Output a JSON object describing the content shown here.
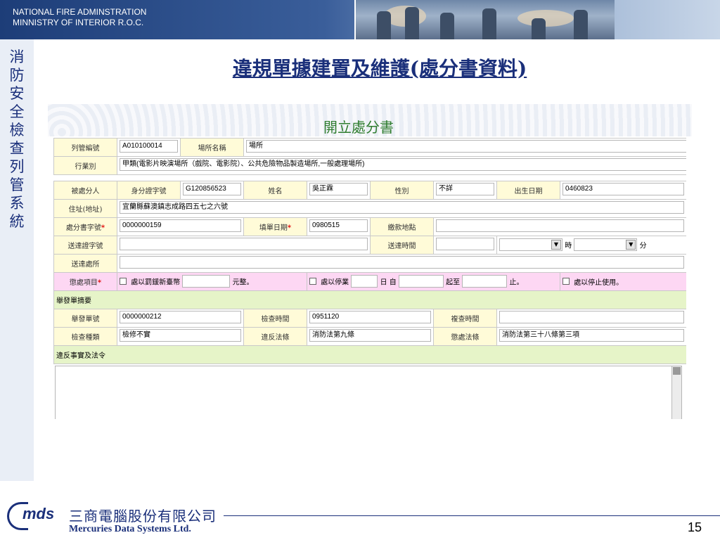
{
  "header": {
    "org_line1": "NATIONAL FIRE ADMINSTRATION",
    "org_line2": "MINNISTRY OF INTERIOR R.O.C."
  },
  "sidebar": {
    "system_name": "消防安全檢查列管系統"
  },
  "slide": {
    "title": "違規單據建置及維護(處分書資料)"
  },
  "form": {
    "title": "開立處分書",
    "row1": {
      "list_no_label": "列管編號",
      "list_no": "A010100014",
      "place_name_label": "場所名稱",
      "place_name": "場所"
    },
    "row2": {
      "category_label": "行業別",
      "category": "甲類(電影片映演場所（戲院、電影院）、公共危險物品製造場所,一般處理場所)"
    },
    "row3": {
      "target_label": "被處分人",
      "id_label": "身分證字號",
      "id_no": "G120856523",
      "name_label": "姓名",
      "name": "吳正霖",
      "sex_label": "性別",
      "sex": "不詳",
      "birth_label": "出生日期",
      "birth": "0460823"
    },
    "row4": {
      "address_label": "住址(地址)",
      "address": "宜蘭縣蘇澳鎮志成路四五七之六號"
    },
    "row5": {
      "doc_no_label": "處分書字號",
      "doc_no": "0000000159",
      "fill_date_label": "填單日期",
      "fill_date": "0980515",
      "pay_place_label": "繳款地點",
      "pay_place": ""
    },
    "row6": {
      "send_no_label": "送達證字號",
      "send_no": "",
      "send_time_label": "送達時間",
      "send_time": "",
      "hour_unit": "時",
      "minute_unit": "分"
    },
    "row7": {
      "send_place_label": "送達處所",
      "send_place": ""
    },
    "row8": {
      "penalty_label": "懲處項目",
      "fine_label": "處以罰鍰新臺幣",
      "fine_unit": "元整。",
      "suspend_label": "處以停業",
      "day_unit": "日",
      "from_label": "自",
      "to_label": "起至",
      "stop_label": "止。",
      "stop_use_label": "處以停止使用。"
    },
    "summary_section": "舉發單摘要",
    "row9": {
      "report_no_label": "舉發單號",
      "report_no": "0000000212",
      "check_time_label": "檢查時間",
      "check_time": "0951120",
      "recheck_time_label": "複查時間",
      "recheck_time": ""
    },
    "row10": {
      "check_type_label": "檢查種類",
      "check_type": "檢修不實",
      "violation_law_label": "違反法條",
      "violation_law": "消防法第九條",
      "penalty_law_label": "懲處法條",
      "penalty_law": "消防法第三十八條第三項"
    },
    "facts_section": "違反事實及法令"
  },
  "footer": {
    "logo_mark": "mds",
    "company_cn": "三商電腦股份有限公司",
    "company_en": "Mercuries Data Systems Ltd.",
    "page_number": "15"
  },
  "colors": {
    "brand_navy": "#1a2f7a",
    "label_bg": "#fffbd8",
    "penalty_bg": "#fdd7f3",
    "section_bg": "#e6f4c8",
    "required_star": "#e00000"
  }
}
